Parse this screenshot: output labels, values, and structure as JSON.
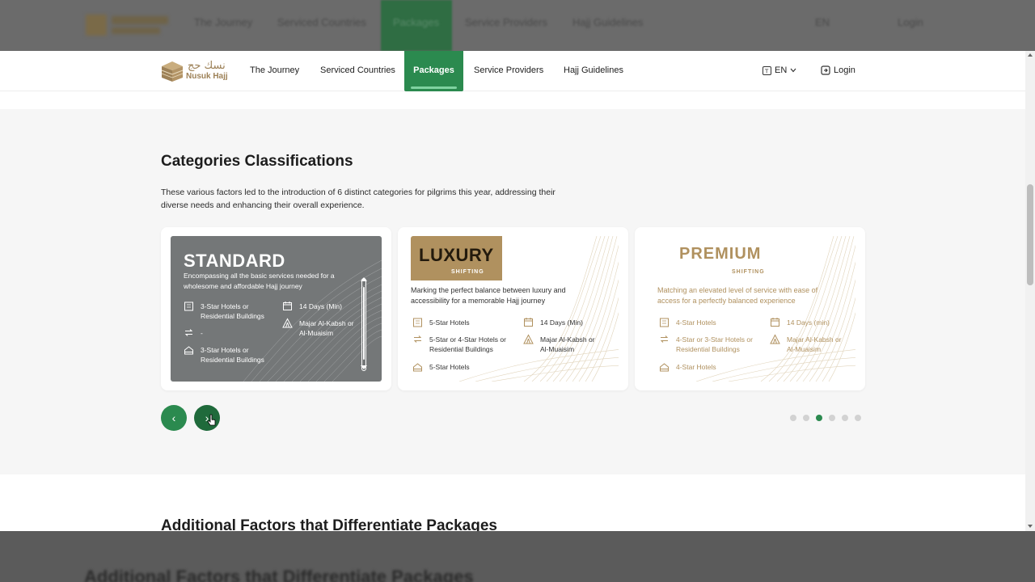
{
  "nav": {
    "brand_ar": "نسك حج",
    "brand": "Nusuk Hajj",
    "items": [
      {
        "label": "The Journey"
      },
      {
        "label": "Serviced Countries"
      },
      {
        "label": "Packages",
        "active": true
      },
      {
        "label": "Service Providers"
      },
      {
        "label": "Hajj Guidelines"
      }
    ],
    "language": "EN",
    "login": "Login"
  },
  "section": {
    "title": "Categories Classifications",
    "description": "These various factors led to the introduction of 6 distinct categories for pilgrims this year, addressing their diverse needs and enhancing their overall experience.",
    "cards": [
      {
        "name": "STANDARD",
        "description": "Encompassing all the basic services needed for a wholesome and affordable Hajj journey",
        "features": {
          "accommodation": "3-Star Hotels or Residential Buildings",
          "duration": "14 Days (Min)",
          "shifting": "-",
          "camp": "Majar Al-Kabsh or Al-Muaisim",
          "other": "3-Star Hotels or Residential Buildings"
        }
      },
      {
        "name": "LUXURY",
        "tag": "SHIFTING",
        "description": "Marking the perfect balance between luxury and accessibility for a memorable Hajj journey",
        "features": {
          "accommodation": "5-Star Hotels",
          "duration": "14 Days (Min)",
          "shifting": "5-Star or 4-Star Hotels or Residential Buildings",
          "camp": "Majar Al-Kabsh or Al-Muaisim",
          "other": "5-Star Hotels"
        }
      },
      {
        "name": "PREMIUM",
        "tag": "SHIFTING",
        "description": "Matching an elevated level of service with ease of access for a perfectly balanced experience",
        "features": {
          "accommodation": "4-Star Hotels",
          "duration": "14 Days (min)",
          "shifting": "4-Star or 3-Star Hotels or Residential Buildings",
          "camp": "Majar Al-Kabsh or Al-Muaisim",
          "other": "4-Star Hotels"
        }
      }
    ],
    "prev_glyph": "‹",
    "next_glyph": "›",
    "pagination": {
      "total": 6,
      "active": 3
    }
  },
  "next_section": {
    "title": "Additional Factors that Differentiate Packages"
  },
  "icons": [
    "building-icon",
    "calendar-icon",
    "transfer-icon",
    "tent-icon",
    "house-icon",
    "language-icon",
    "login-icon",
    "chevron-down-icon"
  ],
  "colors": {
    "brand_green": "#2b8a4f",
    "gold": "#b0915f",
    "standard_gray": "#747778"
  }
}
